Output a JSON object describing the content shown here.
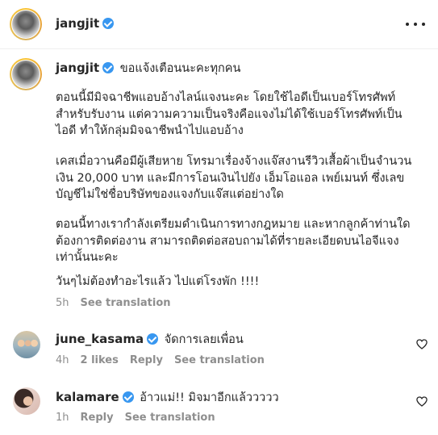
{
  "header": {
    "username": "jangjit"
  },
  "caption": {
    "username": "jangjit",
    "first_line": "ขอแจ้งเตือนนะคะทุกคน",
    "paragraphs": [
      [
        "ตอนนี้มีมิจฉาชีพแอบอ้างไลน์แจงนะคะ โดยใช้ไอดีเป็นเบอร์โทรศัพท์",
        "สำหรับรับงาน แต่ความความเป็นจริงคือแจงไม่ได้ใช้เบอร์โทรศัพท์เป็น",
        "ไอดี ทำให้กลุ่มมิจฉาชีพนำไปแอบอ้าง"
      ],
      [
        "เคสเมื่อวานคือมีผู้เสียหาย โทรมาเรื่องจ้างแจ๊สงานรีวิวเสื้อผ้าเป็นจำนวน",
        "เงิน 20,000 บาท และมีการโอนเงินไปยัง เอ็มโอแอล เพย์เมนท์ ซึ่งเลข",
        "บัญชีไม่ใช่ชื่อบริษัทของแจงกับแจ๊สแต่อย่างใด"
      ],
      [
        "ตอนนี้ทางเรากำลังเตรียมดำเนินการทางกฎหมาย และหากลูกค้าท่านใด",
        "ต้องการติดต่องาน สามารถติดต่อสอบถามได้ที่รายละเอียดบนไอจีแจง",
        "เท่านั้นนะคะ"
      ],
      [
        "วันๆไม่ต้องทำอะไรแล้ว ไปแต่โรงพัก !!!!"
      ]
    ],
    "time": "5h",
    "see_translation": "See translation"
  },
  "comments": [
    {
      "username": "june_kasama",
      "text": "จัดการเลยเพื่อน",
      "time": "4h",
      "likes": "2 likes",
      "reply": "Reply",
      "see_translation": "See translation"
    },
    {
      "username": "kalamare",
      "text": "อ้าวแม่!! มิจมาอีกแล้ววววว",
      "time": "1h",
      "reply": "Reply",
      "see_translation": "See translation"
    }
  ]
}
